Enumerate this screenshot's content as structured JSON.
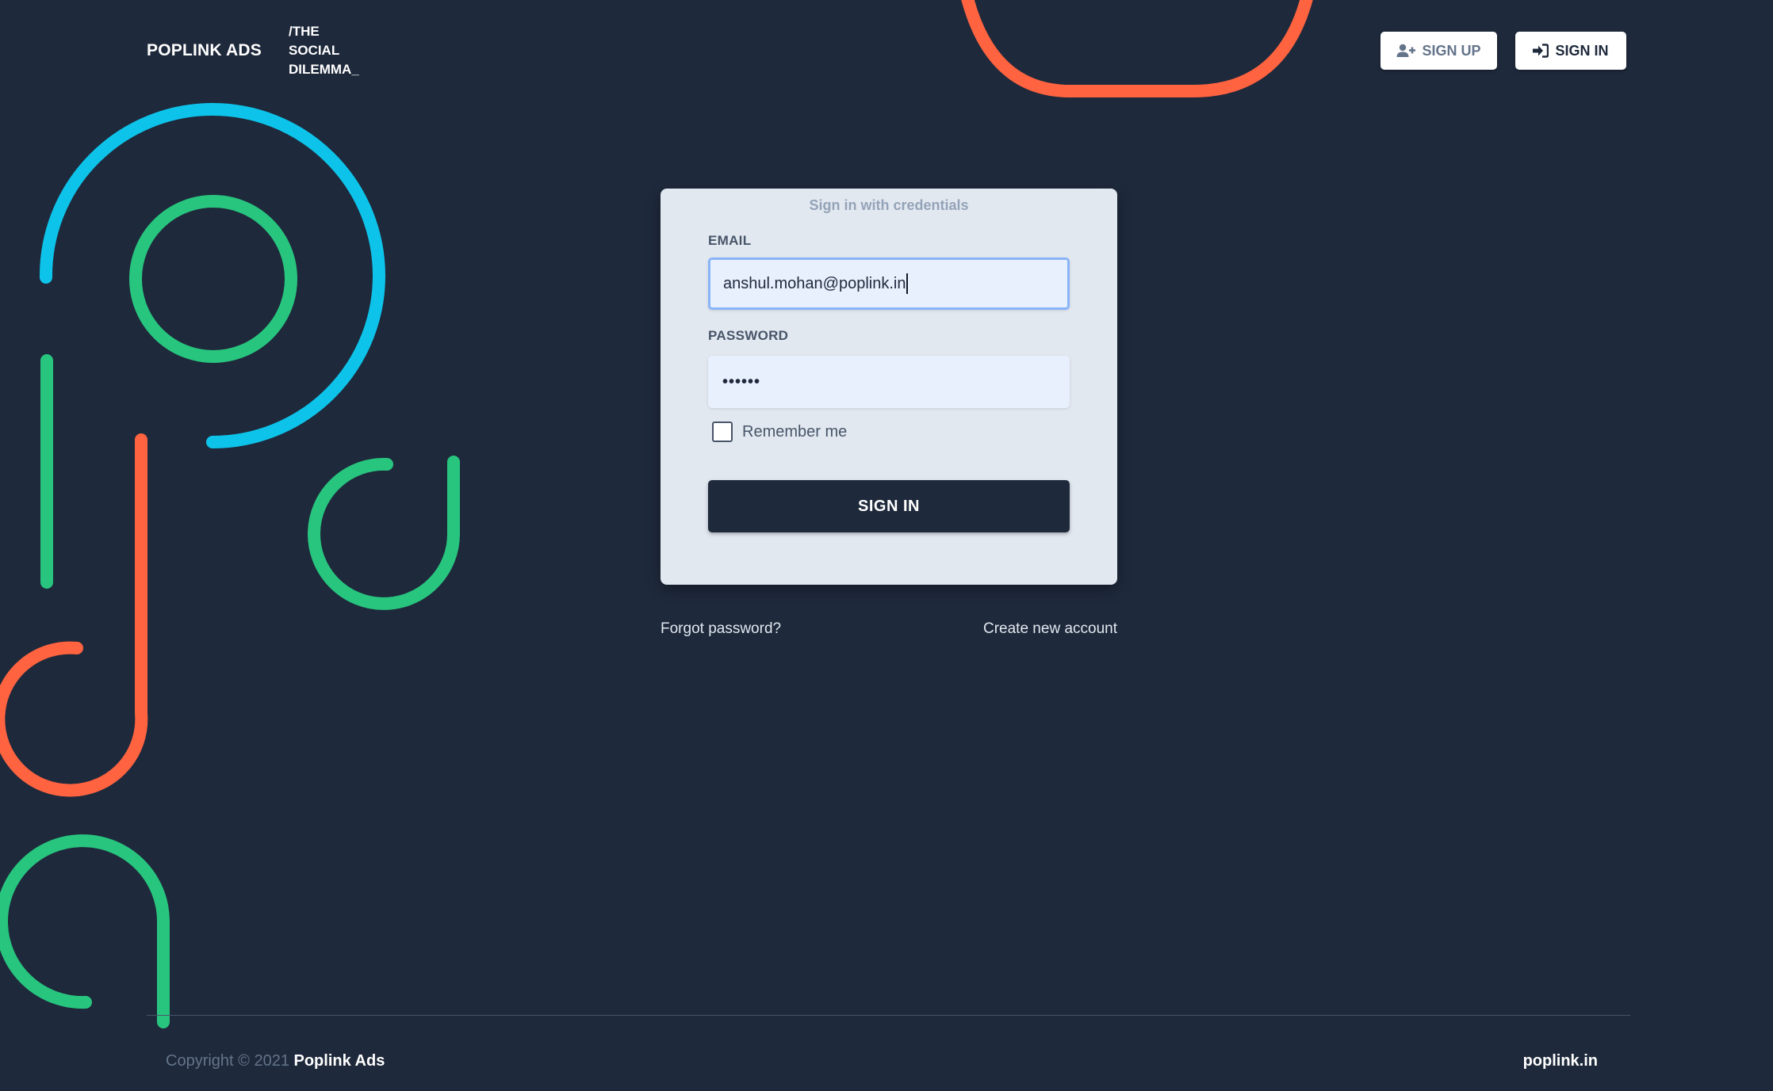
{
  "header": {
    "brand": "POPLINK ADS",
    "tagline": [
      "/THE",
      "SOCIAL",
      "DILEMMA_"
    ],
    "signup_label": "SIGN UP",
    "signin_label": "SIGN IN"
  },
  "login_card": {
    "title": "Sign in with credentials",
    "email_label": "EMAIL",
    "email_value": "anshul.mohan@poplink.in",
    "password_label": "PASSWORD",
    "password_value": "••••••",
    "remember_label": "Remember me",
    "remember_checked": false,
    "submit_label": "SIGN IN"
  },
  "links": {
    "forgot": "Forgot password?",
    "create": "Create new account"
  },
  "footer": {
    "copyright_prefix": "Copyright © 2021",
    "company": "Poplink Ads",
    "site": "poplink.in"
  },
  "colors": {
    "background": "#1e293b",
    "card": "#e2e8f0",
    "accent_blue": "#0ec3ea",
    "accent_green": "#28c57f",
    "accent_orange": "#ff6340"
  },
  "icons": {
    "signup": "user-plus-icon",
    "signin": "sign-in-icon"
  }
}
